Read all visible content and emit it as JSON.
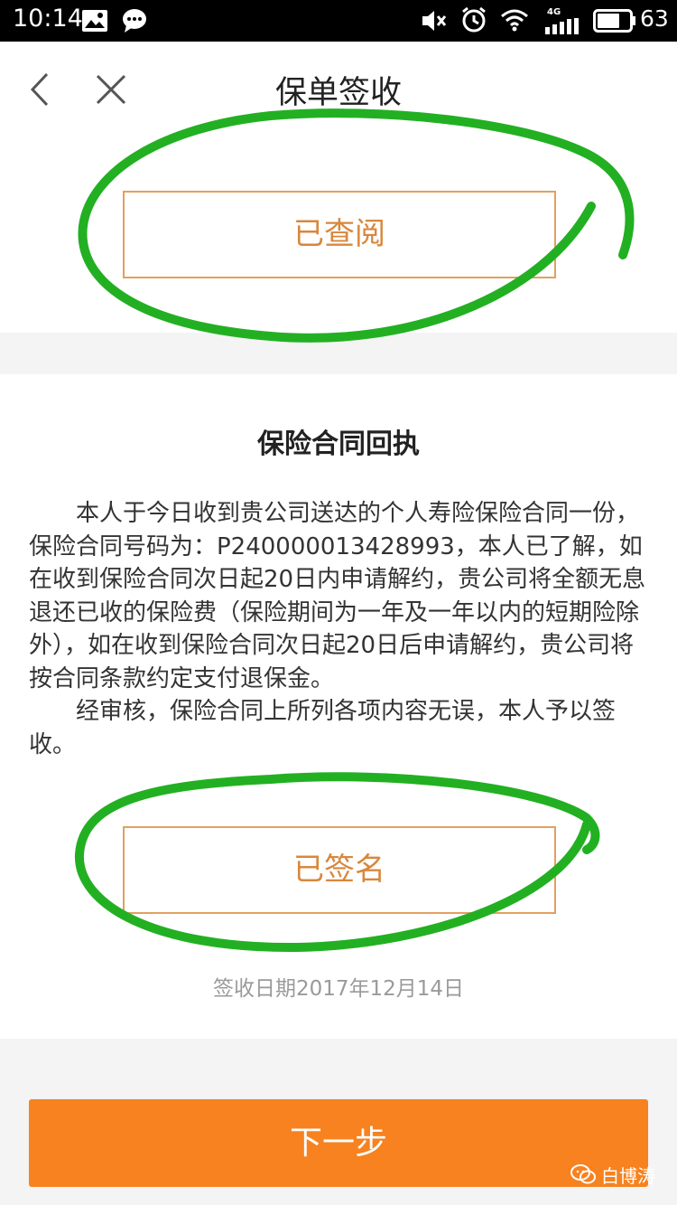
{
  "status_bar": {
    "time": "10:14",
    "network": "4G",
    "battery_level": "63",
    "icons": [
      "image-icon",
      "chat-bubble-icon",
      "mute-icon",
      "alarm-icon",
      "wifi-icon",
      "signal-icon",
      "battery-icon"
    ]
  },
  "header": {
    "title": "保单签收",
    "back_icon": "chevron-left-icon",
    "close_icon": "close-icon"
  },
  "top_card": {
    "reviewed_button_label": "已查阅"
  },
  "receipt": {
    "heading": "保险合同回执",
    "paragraph_1": "本人于今日收到贵公司送达的个人寿险保险合同一份，保险合同号码为：P240000013428993，本人已了解，如在收到保险合同次日起20日内申请解约，贵公司将全额无息退还已收的保险费（保险期间为一年及一年以内的短期险除外），如在收到保险合同次日起20日后申请解约，贵公司将按合同条款约定支付退保金。",
    "paragraph_2": "经审核，保险合同上所列各项内容无误，本人予以签收。",
    "signed_button_label": "已签名",
    "sign_date": "签收日期2017年12月14日"
  },
  "footer": {
    "next_button_label": "下一步"
  },
  "watermark": {
    "text": "白博涛"
  },
  "colors": {
    "status_bar": "#000000",
    "accent_orange": "#f7821f",
    "outline_orange": "#e2a05e",
    "annotation_green": "#22b022"
  }
}
